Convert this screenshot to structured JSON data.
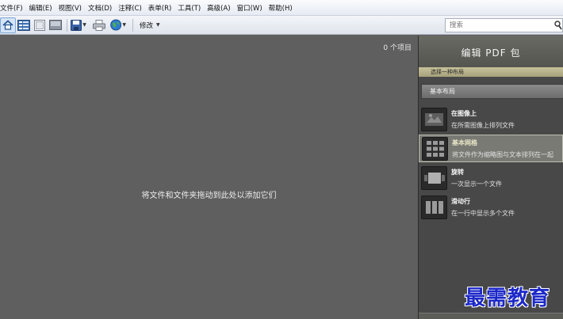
{
  "menubar": {
    "items": [
      "文件(F)",
      "编辑(E)",
      "视图(V)",
      "文档(D)",
      "注释(C)",
      "表单(R)",
      "工具(T)",
      "高级(A)",
      "窗口(W)",
      "帮助(H)"
    ]
  },
  "toolbar": {
    "edit_label": "修改",
    "icons": [
      "home-icon",
      "layout-view-icon",
      "page-view-icon",
      "slide-view-icon",
      "save-icon",
      "print-icon",
      "globe-icon"
    ]
  },
  "search": {
    "placeholder": "搜索"
  },
  "main": {
    "item_count": "0 个项目",
    "drop_hint": "将文件和文件夹拖动到此处以添加它们"
  },
  "panel": {
    "title": "编辑 PDF 包",
    "section_label": "选择一种布局",
    "layout_select": "基本布局",
    "options": [
      {
        "title": "在图像上",
        "desc": "在所需图像上排列文件",
        "icon": "image-layout-icon"
      },
      {
        "title": "基本网格",
        "desc": "将文件作为缩略图与文本排列在一起",
        "icon": "grid-layout-icon"
      },
      {
        "title": "旋转",
        "desc": "一次显示一个文件",
        "icon": "rotate-layout-icon"
      },
      {
        "title": "滑动行",
        "desc": "在一行中显示多个文件",
        "icon": "sliding-row-layout-icon"
      }
    ],
    "selected_index": 1
  },
  "watermark": "最需教育",
  "colors": {
    "watermark": "#1c28c8",
    "panel_accent": "#a7a17c",
    "workspace": "#5f5f5f"
  }
}
